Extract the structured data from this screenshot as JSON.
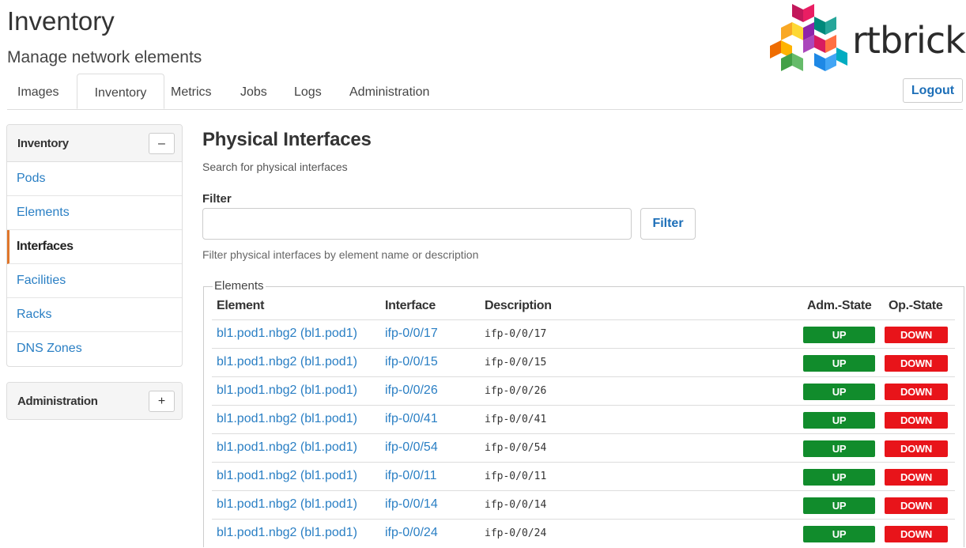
{
  "header": {
    "title": "Inventory",
    "subtitle": "Manage network elements",
    "brand": "rtbrick",
    "logout_label": "Logout"
  },
  "tabs": [
    {
      "label": "Images",
      "active": false
    },
    {
      "label": "Inventory",
      "active": true
    },
    {
      "label": "Metrics",
      "active": false
    },
    {
      "label": "Jobs",
      "active": false
    },
    {
      "label": "Logs",
      "active": false
    },
    {
      "label": "Administration",
      "active": false
    }
  ],
  "sidebar": {
    "inventory": {
      "title": "Inventory",
      "toggle": "–",
      "items": [
        {
          "label": "Pods",
          "active": false
        },
        {
          "label": "Elements",
          "active": false
        },
        {
          "label": "Interfaces",
          "active": true
        },
        {
          "label": "Facilities",
          "active": false
        },
        {
          "label": "Racks",
          "active": false
        },
        {
          "label": "DNS Zones",
          "active": false
        }
      ]
    },
    "administration": {
      "title": "Administration",
      "toggle": "+"
    }
  },
  "main": {
    "title": "Physical Interfaces",
    "subtitle": "Search for physical interfaces",
    "filter": {
      "label": "Filter",
      "value": "",
      "placeholder": "",
      "button_label": "Filter",
      "help": "Filter physical interfaces by element name or description"
    },
    "elements": {
      "legend": "Elements",
      "columns": [
        "Element",
        "Interface",
        "Description",
        "Adm.-State",
        "Op.-State"
      ],
      "rows": [
        {
          "element": "bl1.pod1.nbg2 (bl1.pod1)",
          "interface": "ifp-0/0/17",
          "description": "ifp-0/0/17",
          "adm_state": "UP",
          "op_state": "DOWN"
        },
        {
          "element": "bl1.pod1.nbg2 (bl1.pod1)",
          "interface": "ifp-0/0/15",
          "description": "ifp-0/0/15",
          "adm_state": "UP",
          "op_state": "DOWN"
        },
        {
          "element": "bl1.pod1.nbg2 (bl1.pod1)",
          "interface": "ifp-0/0/26",
          "description": "ifp-0/0/26",
          "adm_state": "UP",
          "op_state": "DOWN"
        },
        {
          "element": "bl1.pod1.nbg2 (bl1.pod1)",
          "interface": "ifp-0/0/41",
          "description": "ifp-0/0/41",
          "adm_state": "UP",
          "op_state": "DOWN"
        },
        {
          "element": "bl1.pod1.nbg2 (bl1.pod1)",
          "interface": "ifp-0/0/54",
          "description": "ifp-0/0/54",
          "adm_state": "UP",
          "op_state": "DOWN"
        },
        {
          "element": "bl1.pod1.nbg2 (bl1.pod1)",
          "interface": "ifp-0/0/11",
          "description": "ifp-0/0/11",
          "adm_state": "UP",
          "op_state": "DOWN"
        },
        {
          "element": "bl1.pod1.nbg2 (bl1.pod1)",
          "interface": "ifp-0/0/14",
          "description": "ifp-0/0/14",
          "adm_state": "UP",
          "op_state": "DOWN"
        },
        {
          "element": "bl1.pod1.nbg2 (bl1.pod1)",
          "interface": "ifp-0/0/24",
          "description": "ifp-0/0/24",
          "adm_state": "UP",
          "op_state": "DOWN"
        }
      ]
    }
  },
  "colors": {
    "link": "#2a7fc4",
    "up": "#118c2c",
    "down": "#e8141a",
    "active_accent": "#e0762b"
  }
}
